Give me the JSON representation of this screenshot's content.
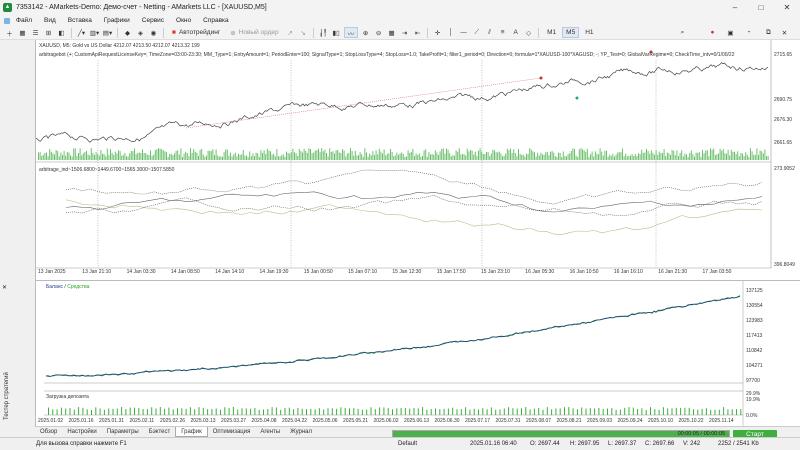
{
  "window": {
    "title": "7353142 - AMarkets-Demo: Демо-счет - Netting - AMarkets LLC - [XAUUSD,M5]",
    "minimize": "–",
    "maximize": "□",
    "close": "✕"
  },
  "menu": [
    "Файл",
    "Вид",
    "Вставка",
    "Графики",
    "Сервис",
    "Окно",
    "Справка"
  ],
  "toolbar": {
    "autotrade": "Автотрейдинг",
    "new_order": "Новый ордер",
    "timeframes": [
      "M1",
      "M5",
      "H1"
    ]
  },
  "chart": {
    "symbol_line": "XAUUSD, M5:  Gold vs US Dollar  4212.07 4213.50 4212.07 4213.32  199",
    "ea_line": "arbitragebot (+; CustomApiRequestLicenseKey=; TimeZone=03:00-23:30; MM_Type=1; EntryAmount=1; PeriodEnter=100; SignalType=1; StopLossType=4; StopLoss=1.0; TakeProfit=1; filter1_period=0; Direction=0; formula=1*XAUUSD-100*XAGUSD; -; YP_Test=0; GlobalVarRegime=0; CheckTime_intv=0/1/00/22",
    "indicator_line": "arbitrage_ind~1506.6800~1449.6700~1565.3000~1507.5850",
    "y_labels": [
      "2715.65",
      "2690.75",
      "2676.30",
      "2661.65"
    ],
    "ind_y_labels": [
      "273.9052",
      "396.8049"
    ],
    "x_labels": [
      "13 Jan 2025",
      "13 Jan 21:10",
      "14 Jan 03:30",
      "14 Jan 08:50",
      "14 Jan 14:10",
      "14 Jan 19:30",
      "15 Jan 00:50",
      "15 Jan 07:10",
      "15 Jan 12:30",
      "15 Jan 17:50",
      "15 Jan 23:10",
      "16 Jan 05:30",
      "16 Jan 10:50",
      "16 Jan 16:10",
      "16 Jan 21:30",
      "17 Jan 03:50"
    ]
  },
  "tester": {
    "legend_balance": "Баланс",
    "legend_sep": " / ",
    "legend_equity": "Средства",
    "deposit_load": "Загрузка депозита",
    "y_labels": [
      "137125",
      "130554",
      "123983",
      "117413",
      "110842",
      "104271",
      "97700"
    ],
    "load_y": [
      "29.9%",
      "19.9%",
      "0.0%"
    ],
    "x_labels": [
      "2025.01.02",
      "2025.01.16",
      "2025.01.31",
      "2025.02.11",
      "2025.02.26",
      "2025.03.13",
      "2025.03.27",
      "2025.04.08",
      "2025.04.22",
      "2025.05.06",
      "2025.05.21",
      "2025.06.02",
      "2025.06.13",
      "2025.06.30",
      "2025.07.17",
      "2025.07.31",
      "2025.08.07",
      "2025.08.21",
      "2025.09.03",
      "2025.09.24",
      "2025.10.10",
      "2025.10.22",
      "2025.11.14"
    ],
    "side_label": "Тестер стратегий",
    "progress_text": "00:00:05 / 00:00:05",
    "progress_value": 1.0,
    "start": "Старт",
    "colors": {
      "balance": "#1f3b8a",
      "equity": "#2aa52a"
    }
  },
  "tabs": [
    "Обзор",
    "Настройки",
    "Параметры",
    "Бэктест",
    "График",
    "Оптимизация",
    "Агенты",
    "Журнал"
  ],
  "active_tab": "График",
  "status": {
    "help": "Для вызова справки нажмите F1",
    "profile": "Default",
    "datetime": "2025.01.16 06:40",
    "open": "O: 2697.44",
    "high": "H: 2697.95",
    "low": "L: 2697.37",
    "close": "C: 2697.66",
    "volume": "V: 242",
    "traffic": "2252 / 2541 Kb"
  }
}
